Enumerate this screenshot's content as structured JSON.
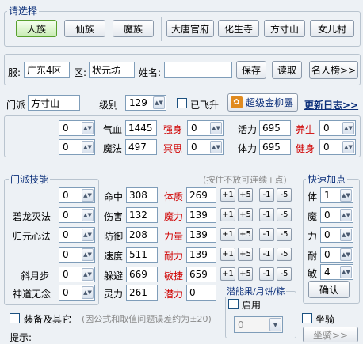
{
  "select": {
    "legend": "请选择",
    "races": [
      "人族",
      "仙族",
      "魔族"
    ],
    "schools": [
      "大唐官府",
      "化生寺",
      "方寸山",
      "女儿村"
    ]
  },
  "server": {
    "server_label": "服:",
    "server_value": "广东4区",
    "district_label": "区:",
    "district_value": "状元坊",
    "name_label": "姓名:",
    "name_value": "",
    "save": "保存",
    "load": "读取",
    "famous": "名人榜>>"
  },
  "school": {
    "label": "门派",
    "value": "方寸山",
    "level_label": "级别",
    "level_value": "129",
    "fly_label": "已飞升",
    "super_label": "超级金柳露",
    "update_log": "更新日志>>"
  },
  "top_stats": {
    "left_spins": [
      "0",
      "0"
    ],
    "rows": [
      {
        "label": "气血",
        "value": "1445",
        "skill": "强身",
        "skill_val": "0",
        "label2": "活力",
        "value2": "695",
        "skill2": "养生",
        "skill2_val": "0"
      },
      {
        "label": "魔法",
        "value": "497",
        "skill": "冥思",
        "skill_val": "0",
        "label2": "体力",
        "value2": "695",
        "skill2": "健身",
        "skill2_val": "0"
      }
    ]
  },
  "school_skills": {
    "legend": "门派技能",
    "items": [
      {
        "name": "",
        "value": "0"
      },
      {
        "name": "碧龙灭法",
        "value": "0"
      },
      {
        "name": "归元心法",
        "value": "0"
      },
      {
        "name": "",
        "value": "0"
      },
      {
        "name": "斜月步",
        "value": "0"
      },
      {
        "name": "神道无念",
        "value": "0"
      }
    ]
  },
  "attributes": {
    "hint": "(按住不放可连续+点)",
    "rows": [
      {
        "label": "命中",
        "value": "308",
        "attr": "体质",
        "attr_val": "269"
      },
      {
        "label": "伤害",
        "value": "132",
        "attr": "魔力",
        "attr_val": "139"
      },
      {
        "label": "防御",
        "value": "208",
        "attr": "力量",
        "attr_val": "139"
      },
      {
        "label": "速度",
        "value": "511",
        "attr": "耐力",
        "attr_val": "139"
      },
      {
        "label": "躲避",
        "value": "669",
        "attr": "敏捷",
        "attr_val": "659"
      },
      {
        "label": "灵力",
        "value": "261",
        "attr": "潜力",
        "attr_val": "0"
      }
    ],
    "buttons": [
      "+1",
      "+5",
      "-1",
      "-5"
    ]
  },
  "quick": {
    "legend": "快速加点",
    "rows": [
      {
        "label": "体",
        "value": "1"
      },
      {
        "label": "魔",
        "value": "0"
      },
      {
        "label": "力",
        "value": "0"
      },
      {
        "label": "耐",
        "value": "0"
      },
      {
        "label": "敏",
        "value": "4"
      }
    ],
    "confirm": "确认"
  },
  "potential": {
    "legend": "潜能果/月饼/粽",
    "enable_label": "启用",
    "value": "0"
  },
  "bottom": {
    "equip_label": "装备及其它",
    "note": "(因公式和取值问题误差约为±20)",
    "mount_label": "坐骑",
    "mount_btn": "坐骑>>",
    "tip_label": "提示:"
  }
}
